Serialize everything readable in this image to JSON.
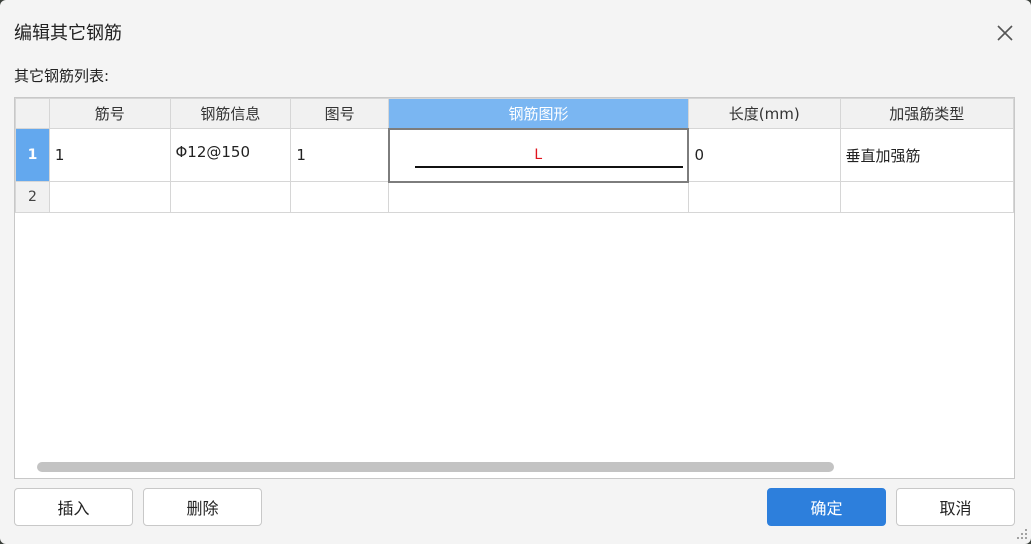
{
  "dialog": {
    "title": "编辑其它钢筋",
    "list_label": "其它钢筋列表:"
  },
  "table": {
    "columns": [
      "",
      "筋号",
      "钢筋信息",
      "图号",
      "钢筋图形",
      "长度(mm)",
      "加强筋类型"
    ],
    "active_column_index": 4,
    "rows": [
      {
        "num": "1",
        "bar_no": "1",
        "bar_info": "Φ12@150",
        "fig_no": "1",
        "shape_label": "L",
        "length": "0",
        "type": "垂直加强筋"
      },
      {
        "num": "2",
        "bar_no": "",
        "bar_info": "",
        "fig_no": "",
        "shape_label": "",
        "length": "",
        "type": ""
      }
    ]
  },
  "buttons": {
    "insert": "插入",
    "delete": "删除",
    "ok": "确定",
    "cancel": "取消"
  },
  "icons": {
    "close": "close-icon",
    "resize": "resize-grip-icon"
  },
  "colors": {
    "accent": "#2d7fdc",
    "header_active": "#7ab6f2",
    "shape_text": "#e0141e"
  }
}
